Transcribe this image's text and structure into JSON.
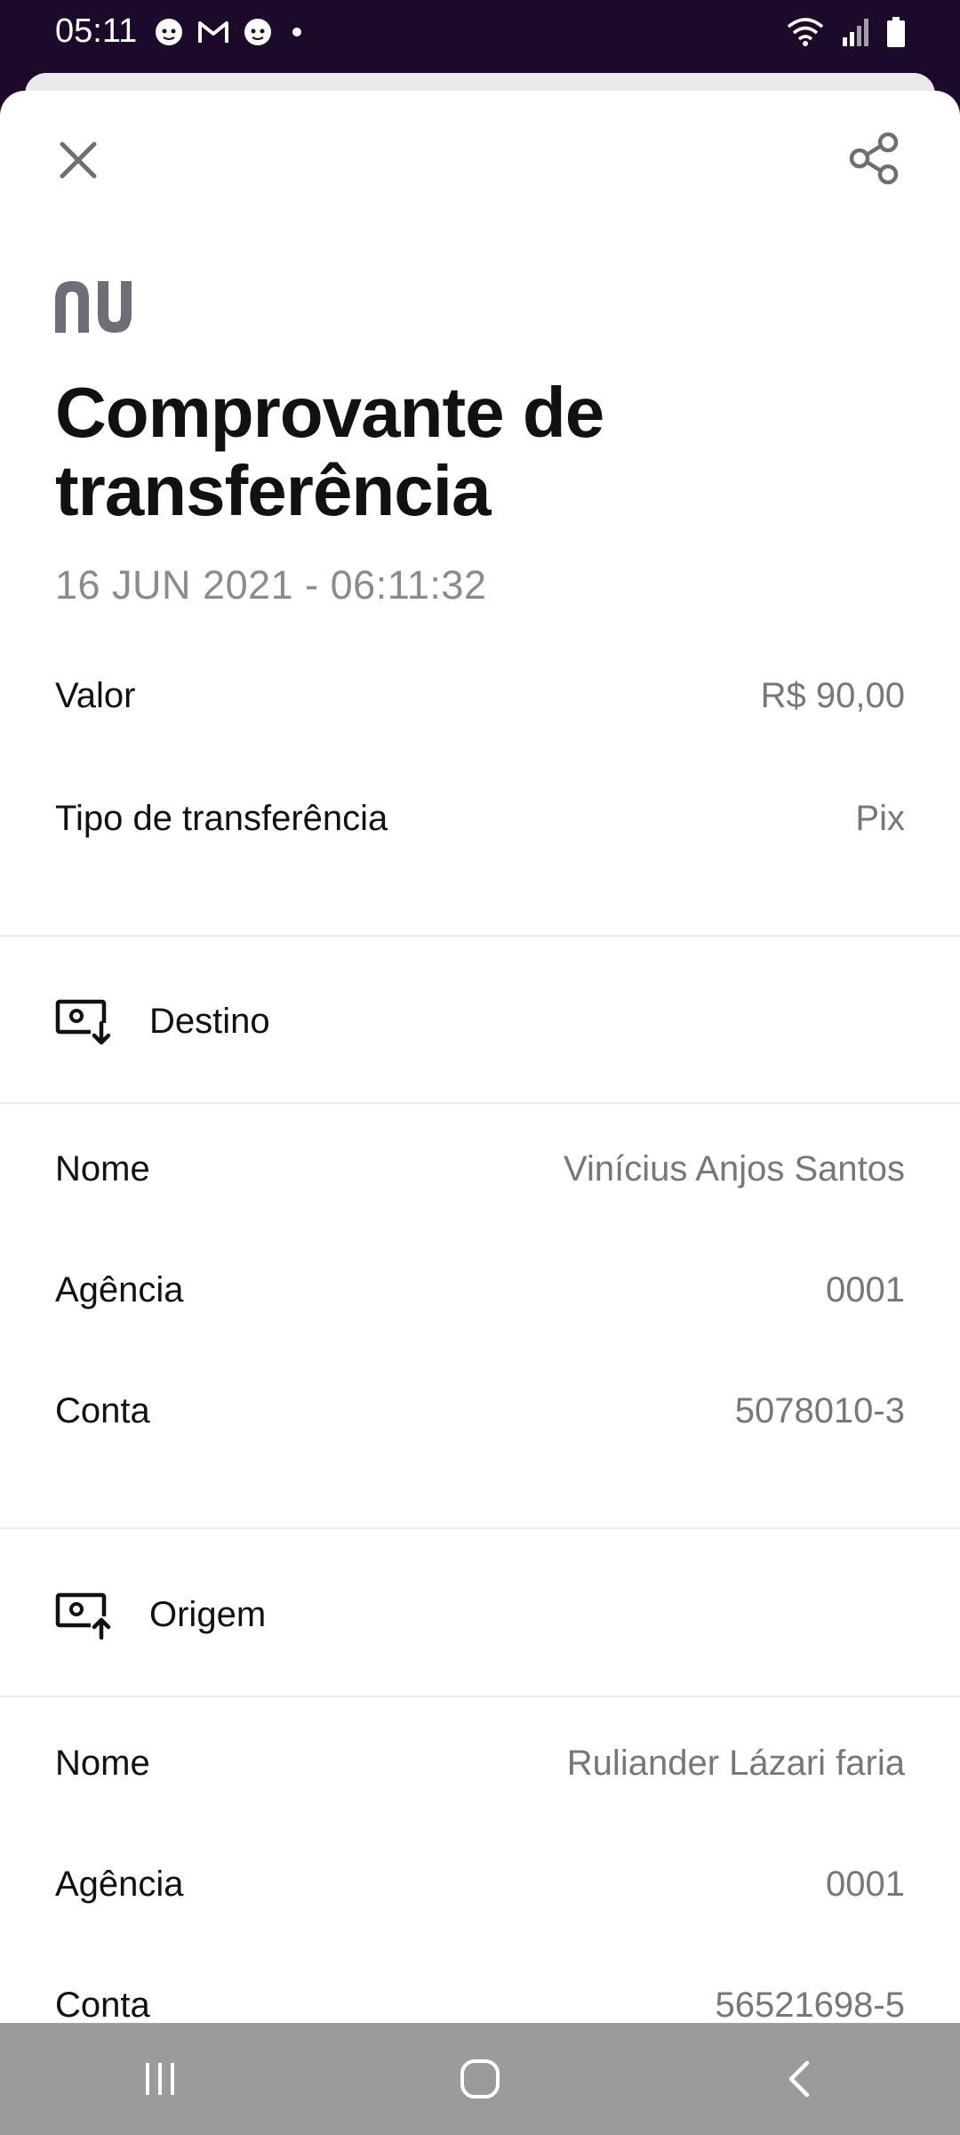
{
  "status_bar": {
    "time": "05:11",
    "left_icons": [
      "face-icon",
      "gmail-icon",
      "face-icon",
      "dot-icon"
    ],
    "right_icons": [
      "wifi-icon",
      "signal-icon",
      "battery-icon"
    ]
  },
  "header": {
    "close_icon": "close-icon",
    "share_icon": "share-icon"
  },
  "brand": {
    "logo": "nu"
  },
  "receipt": {
    "title": "Comprovante de transferência",
    "datetime": "16 JUN 2021 - 06:11:32",
    "summary": [
      {
        "label": "Valor",
        "value": "R$ 90,00"
      },
      {
        "label": "Tipo de transferência",
        "value": "Pix"
      }
    ],
    "destination": {
      "heading": "Destino",
      "icon": "money-download-icon",
      "rows": [
        {
          "label": "Nome",
          "value": "Vinícius Anjos Santos"
        },
        {
          "label": "Agência",
          "value": "0001"
        },
        {
          "label": "Conta",
          "value": "5078010-3"
        }
      ]
    },
    "origin": {
      "heading": "Origem",
      "icon": "money-upload-icon",
      "rows": [
        {
          "label": "Nome",
          "value": "Ruliander Lázari faria"
        },
        {
          "label": "Agência",
          "value": "0001"
        },
        {
          "label": "Conta",
          "value": "56521698-5"
        }
      ]
    }
  },
  "nav_bar": {
    "buttons": [
      "recents-icon",
      "home-icon",
      "back-icon"
    ]
  },
  "colors": {
    "status_bar_bg": "#1c0a2a",
    "text_primary": "#111111",
    "text_secondary": "#77767e",
    "icon_gray": "#6e6e76",
    "nav_bar_bg": "#9b9b9b"
  }
}
